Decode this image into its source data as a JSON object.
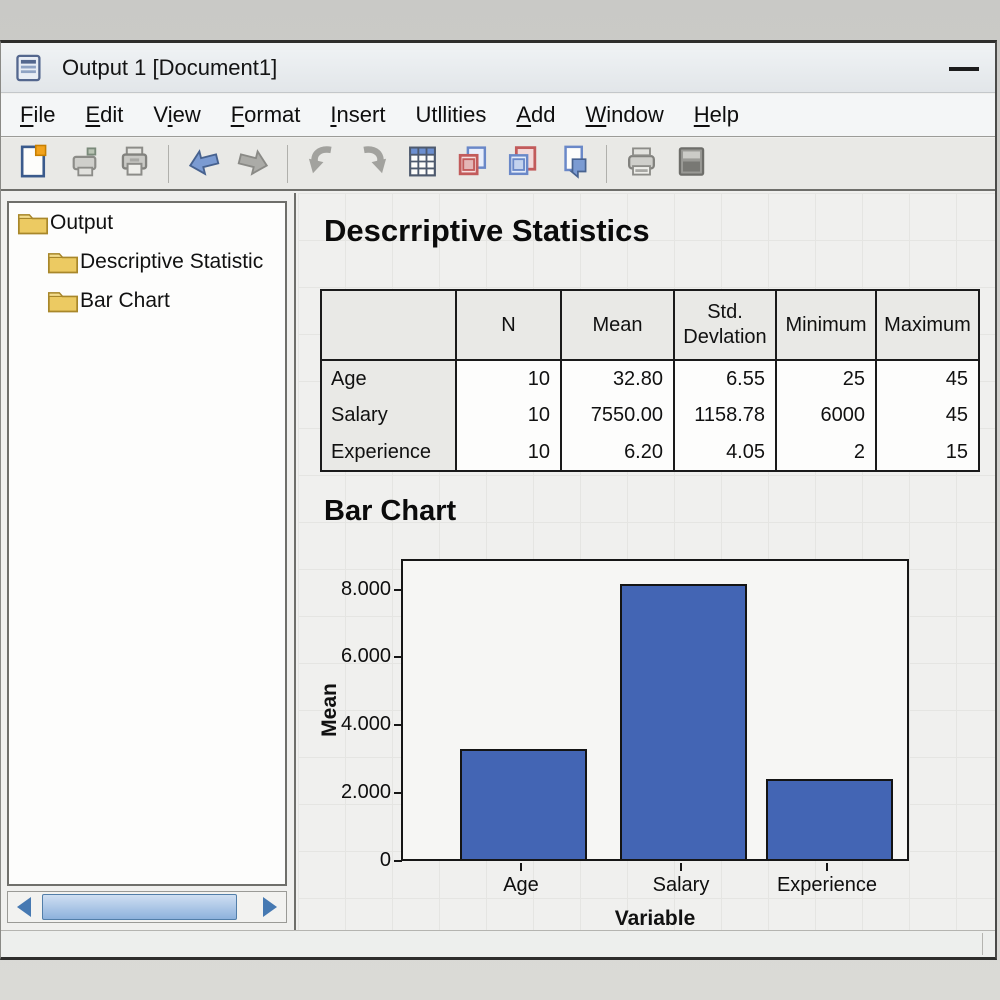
{
  "window": {
    "title": "Output 1 [Document1]",
    "controls": [
      "minimize"
    ]
  },
  "menu": {
    "items": [
      {
        "label": "File",
        "underline": 0
      },
      {
        "label": "Edit",
        "underline": 0
      },
      {
        "label": "View",
        "underline": 1
      },
      {
        "label": "Format",
        "underline": 0
      },
      {
        "label": "Insert",
        "underline": 0
      },
      {
        "label": "Utllities",
        "underline": -1
      },
      {
        "label": "Add",
        "underline": 0
      },
      {
        "label": "Window",
        "underline": 0
      },
      {
        "label": "Help",
        "underline": 0
      }
    ]
  },
  "toolbar": {
    "items": [
      "new-document",
      "print-preview",
      "print",
      "|",
      "go-back",
      "go-forward",
      "|",
      "undo",
      "redo",
      "data-table",
      "windows-overlap-red",
      "windows-overlap-red-alt",
      "insert-object",
      "|",
      "printer-setup",
      "output-panel"
    ]
  },
  "sidebar": {
    "items": [
      {
        "label": "Output",
        "level": 0
      },
      {
        "label": "Descriptive Statistic",
        "level": 1
      },
      {
        "label": "Bar Chart",
        "level": 1
      }
    ]
  },
  "content": {
    "section1_title": "Descrriptive Statistics",
    "section2_title": "Bar Chart",
    "table": {
      "columns": [
        "",
        "N",
        "Mean",
        "Std. Devlation",
        "Minimum",
        "Maximum"
      ],
      "rows": [
        {
          "label": "Age",
          "values": [
            "10",
            "32.80",
            "6.55",
            "25",
            "45"
          ]
        },
        {
          "label": "Salary",
          "values": [
            "10",
            "7550.00",
            "1158.78",
            "6000",
            "45"
          ]
        },
        {
          "label": "Experience",
          "values": [
            "10",
            "6.20",
            "4.05",
            "2",
            "15"
          ]
        }
      ]
    }
  },
  "chart_data": {
    "type": "bar",
    "title": "Bar Chart",
    "categories": [
      "Age",
      "Salary",
      "Experience"
    ],
    "values": [
      3250,
      8100,
      2350
    ],
    "xlabel": "Variable",
    "ylabel": "Mean",
    "ylim": [
      0,
      8900
    ],
    "yticks_values": [
      0,
      2000,
      4000,
      6000,
      8000
    ],
    "yticks_labels": [
      "0",
      "2.000",
      "4.000",
      "6.000",
      "8.000"
    ],
    "grid": false,
    "legend": "none",
    "bar_color": "#4365b4",
    "bar_border": "#141414",
    "plot_bg": "#f6f6f4"
  },
  "colors": {
    "bar_blue": "#4365b4",
    "folder_yellow": "#ecca62",
    "scrollbar_blue": "#8db1dc",
    "window_bg": "#f0f0ee",
    "table_header_bg": "#e9e9e6"
  }
}
